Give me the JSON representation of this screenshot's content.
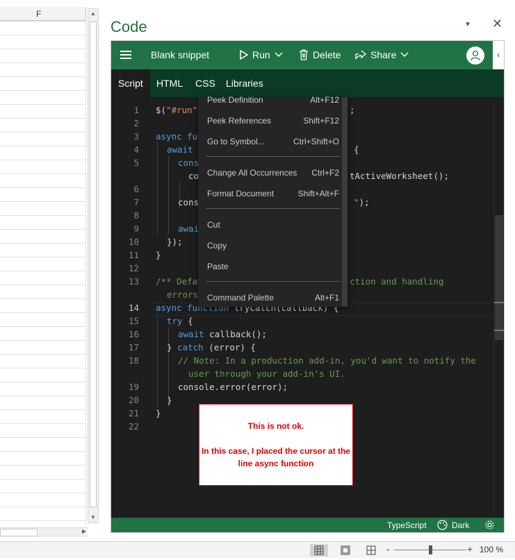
{
  "sheet": {
    "column_header": "F"
  },
  "pane": {
    "title": "Code",
    "collapse_icon": "chevron-down-icon",
    "close_icon": "close-icon"
  },
  "header": {
    "menu_icon": "hamburger-icon",
    "snippet_name": "Blank snippet",
    "run_label": "Run",
    "delete_label": "Delete",
    "share_label": "Share"
  },
  "tabs": [
    {
      "label": "Script",
      "active": true
    },
    {
      "label": "HTML",
      "active": false
    },
    {
      "label": "CSS",
      "active": false
    },
    {
      "label": "Libraries",
      "active": false
    }
  ],
  "editor": {
    "current_line": 14,
    "line_numbers": [
      "1",
      "2",
      "3",
      "4",
      "5",
      "6",
      "7",
      "8",
      "9",
      "10",
      "11",
      "12",
      "13",
      "14",
      "15",
      "16",
      "17",
      "18",
      "19",
      "20",
      "21",
      "22"
    ]
  },
  "context_menu": {
    "items": [
      {
        "label": "Peek Definition",
        "shortcut": "Alt+F12"
      },
      {
        "label": "Peek References",
        "shortcut": "Shift+F12"
      },
      {
        "label": "Go to Symbol...",
        "shortcut": "Ctrl+Shift+O"
      },
      {
        "label": "Change All Occurrences",
        "shortcut": "Ctrl+F2"
      },
      {
        "label": "Format Document",
        "shortcut": "Shift+Alt+F"
      },
      {
        "label": "Cut",
        "shortcut": ""
      },
      {
        "label": "Copy",
        "shortcut": ""
      },
      {
        "label": "Paste",
        "shortcut": ""
      },
      {
        "label": "Command Palette",
        "shortcut": "Alt+F1"
      }
    ]
  },
  "status": {
    "language": "TypeScript",
    "theme": "Dark"
  },
  "note": {
    "line1": "This is not ok.",
    "line2": "In this case, I placed the cursor at the line async function"
  },
  "excel_status": {
    "zoom_minus": "-",
    "zoom_plus": "+",
    "zoom": "100 %"
  },
  "colors": {
    "accent": "#217346",
    "tab_bar": "#0b3b25",
    "editor_bg": "#1e1e1e",
    "note_text": "#e00000"
  }
}
